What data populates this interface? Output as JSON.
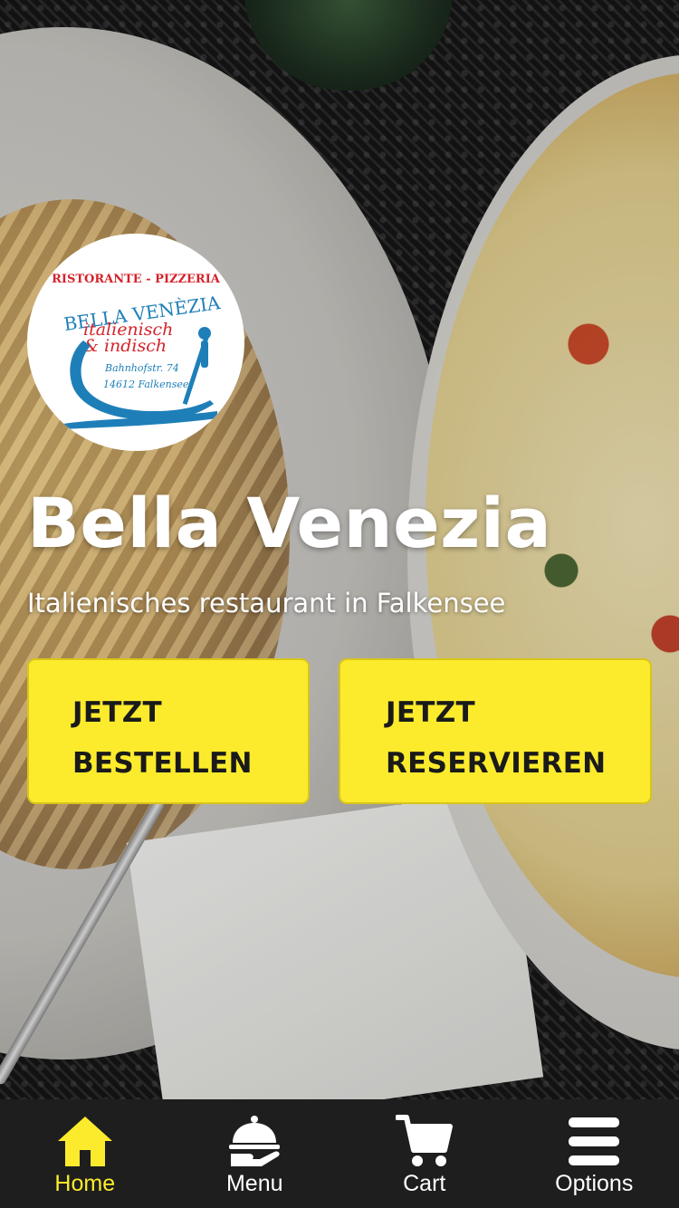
{
  "restaurant": {
    "name": "Bella Venezia",
    "tagline": "Italienisches restaurant in Falkensee"
  },
  "logo": {
    "line1": "RISTORANTE - PIZZERIA",
    "line2": "BELLA VENÈZIA",
    "line3": "italienisch",
    "line4": "& indisch",
    "address_street": "Bahnhofstr. 74",
    "address_city": "14612 Falkensee"
  },
  "actions": {
    "order_line1": "JETZT",
    "order_line2": "BESTELLEN",
    "reserve_line1": "JETZT",
    "reserve_line2": "RESERVIEREN"
  },
  "nav": {
    "items": [
      {
        "label": "Home",
        "icon": "home-icon",
        "active": true
      },
      {
        "label": "Menu",
        "icon": "cloche-icon",
        "active": false
      },
      {
        "label": "Cart",
        "icon": "cart-icon",
        "active": false
      },
      {
        "label": "Options",
        "icon": "hamburger-icon",
        "active": false
      }
    ]
  },
  "colors": {
    "accent": "#fceb2c",
    "nav_background": "#1e1e1e",
    "logo_red": "#d4232b",
    "logo_blue": "#1e7fb8"
  }
}
